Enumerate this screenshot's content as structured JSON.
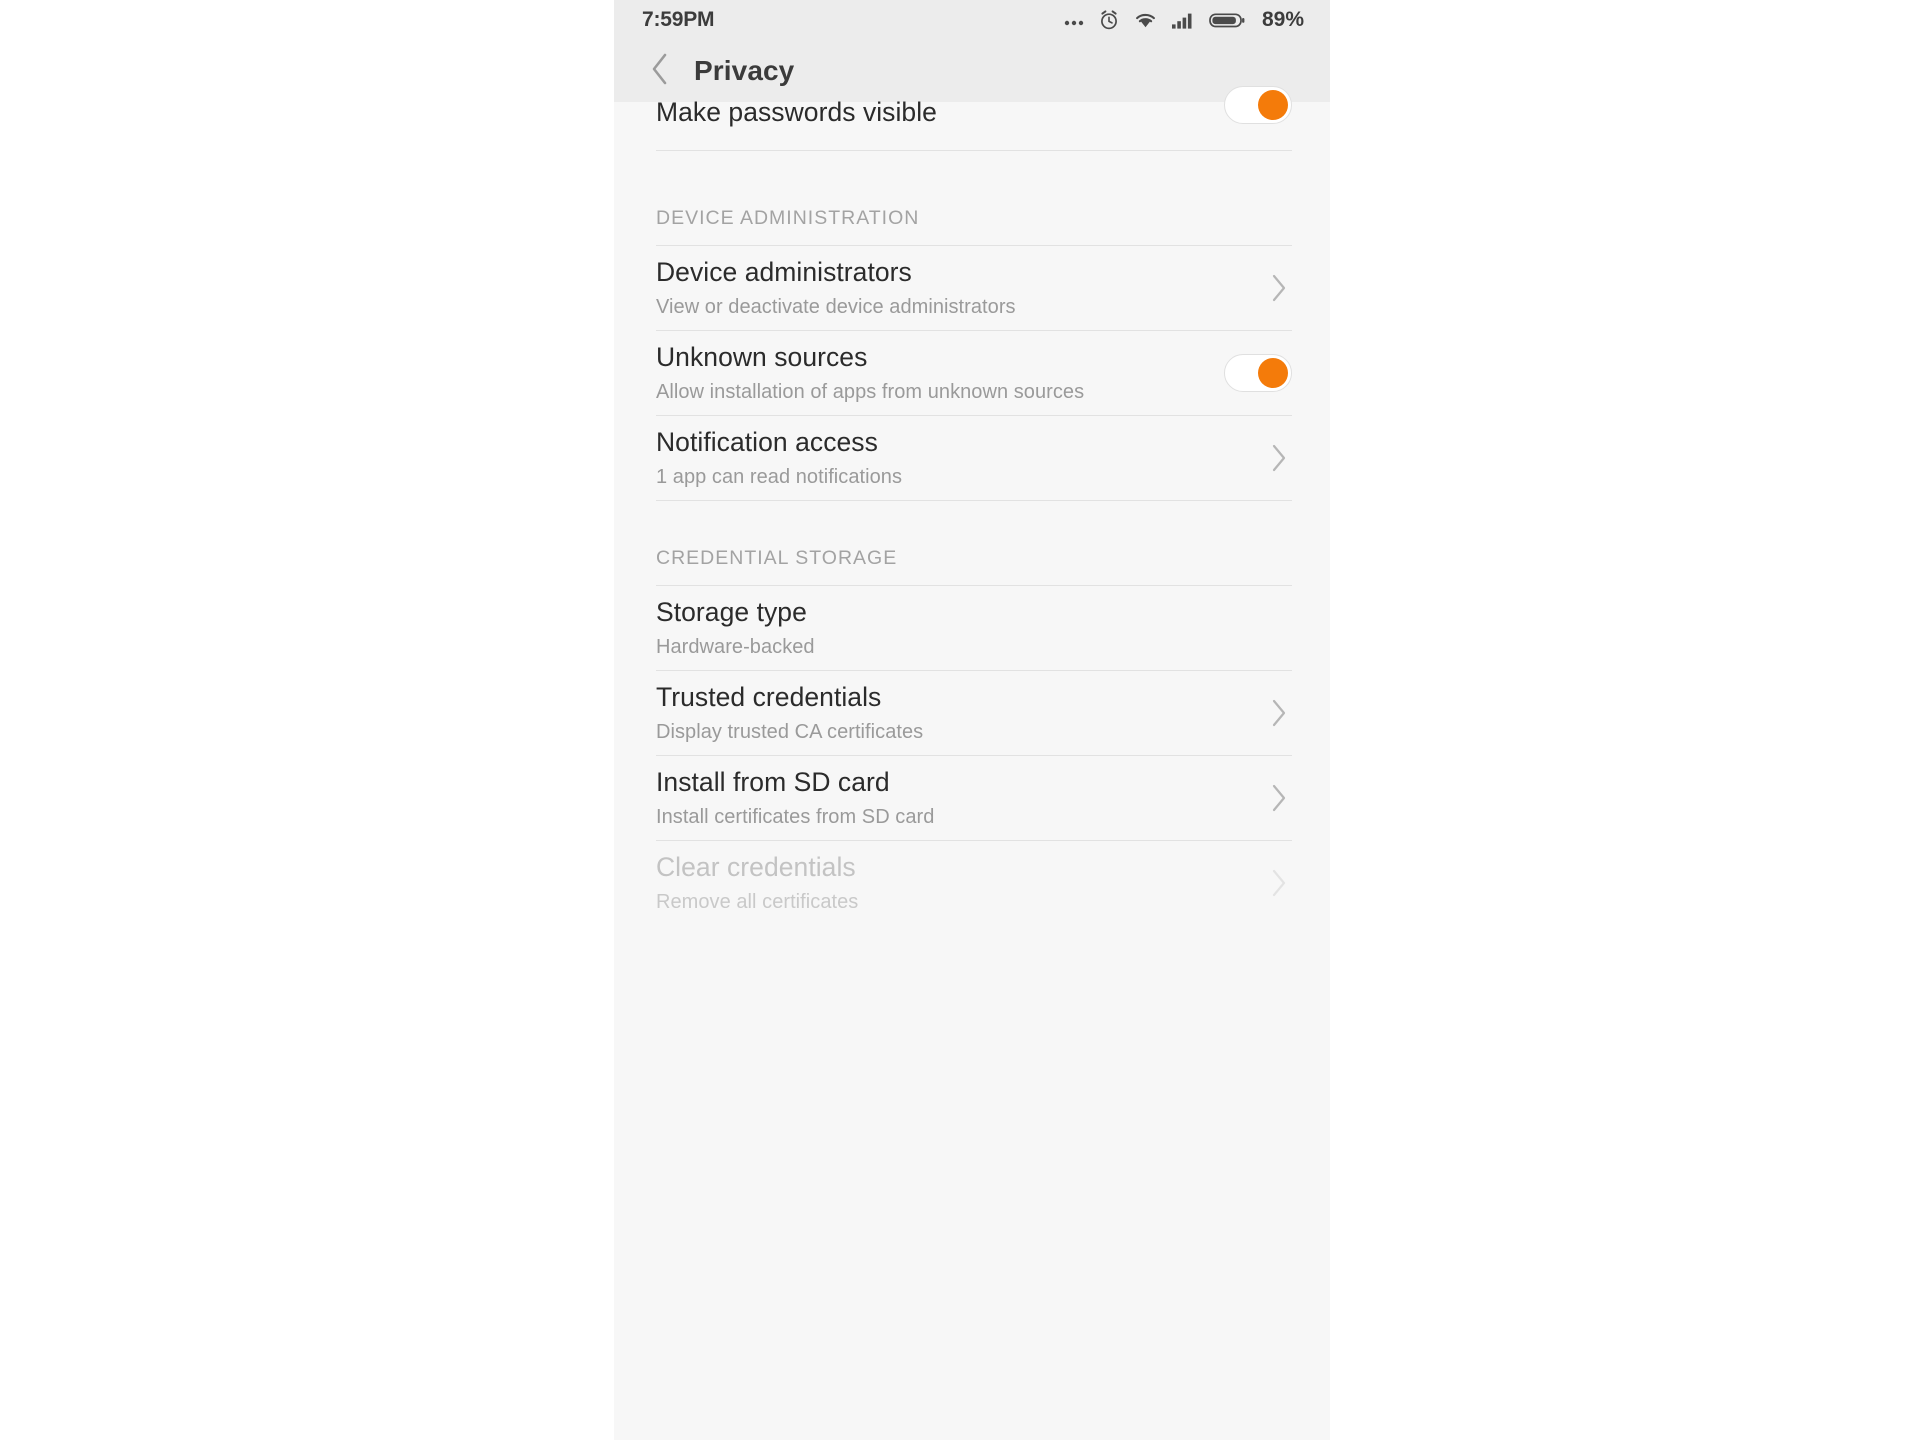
{
  "statusbar": {
    "time": "7:59PM",
    "battery_percent": "89%",
    "icons": [
      "more-dots-icon",
      "alarm-clock-icon",
      "wifi-icon",
      "signal-bars-icon",
      "battery-icon"
    ]
  },
  "header": {
    "title": "Privacy",
    "back_icon": "chevron-left-icon"
  },
  "theme": {
    "accent": "#f47b0a",
    "statusbar_bg": "#ececec",
    "content_bg": "#f7f7f7",
    "title_color": "#2b2b2b",
    "subtitle_color": "#9a9a9a",
    "divider_color": "#e2e2e2",
    "disabled_color": "#c3c3c3"
  },
  "rows": {
    "make_passwords_visible": {
      "title": "Make passwords visible",
      "toggle_on": true
    },
    "device_administration_label": "DEVICE ADMINISTRATION",
    "device_administrators": {
      "title": "Device administrators",
      "subtitle": "View or deactivate device administrators"
    },
    "unknown_sources": {
      "title": "Unknown sources",
      "subtitle": "Allow installation of apps from unknown sources",
      "toggle_on": true
    },
    "notification_access": {
      "title": "Notification access",
      "subtitle": "1 app can read notifications"
    },
    "credential_storage_label": "CREDENTIAL STORAGE",
    "storage_type": {
      "title": "Storage type",
      "subtitle": "Hardware-backed"
    },
    "trusted_credentials": {
      "title": "Trusted credentials",
      "subtitle": "Display trusted CA certificates"
    },
    "install_from_sd_card": {
      "title": "Install from SD card",
      "subtitle": "Install certificates from SD card"
    },
    "clear_credentials": {
      "title": "Clear credentials",
      "subtitle": "Remove all certificates",
      "disabled": true
    }
  }
}
